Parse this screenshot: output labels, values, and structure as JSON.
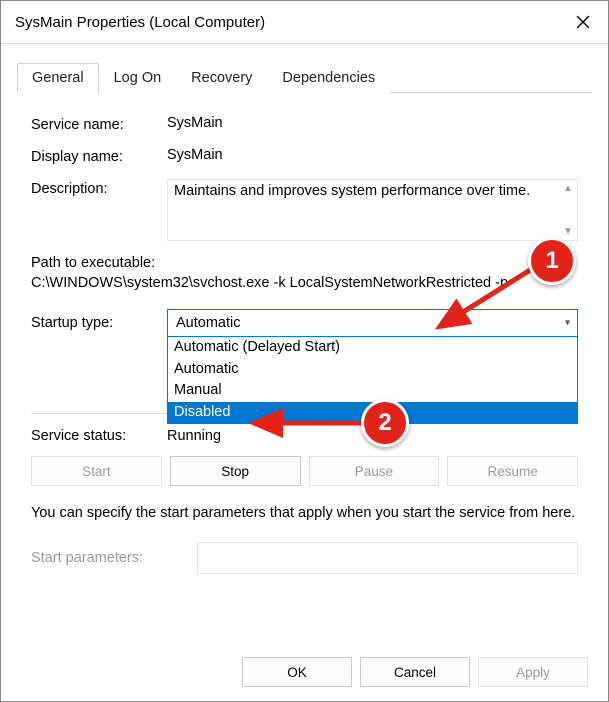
{
  "window": {
    "title": "SysMain Properties (Local Computer)"
  },
  "tabs": [
    {
      "label": "General"
    },
    {
      "label": "Log On"
    },
    {
      "label": "Recovery"
    },
    {
      "label": "Dependencies"
    }
  ],
  "labels": {
    "service_name": "Service name:",
    "display_name": "Display name:",
    "description": "Description:",
    "path_label": "Path to executable:",
    "startup_type": "Startup type:",
    "service_status": "Service status:",
    "start_parameters": "Start parameters:"
  },
  "service": {
    "name": "SysMain",
    "display_name": "SysMain",
    "description": "Maintains and improves system performance over time.",
    "path": "C:\\WINDOWS\\system32\\svchost.exe -k LocalSystemNetworkRestricted -p",
    "startup_selected": "Automatic",
    "startup_options": [
      "Automatic (Delayed Start)",
      "Automatic",
      "Manual",
      "Disabled"
    ],
    "status": "Running",
    "start_parameters": ""
  },
  "hint": "You can specify the start parameters that apply when you start the service from here.",
  "buttons": {
    "start": "Start",
    "stop": "Stop",
    "pause": "Pause",
    "resume": "Resume",
    "ok": "OK",
    "cancel": "Cancel",
    "apply": "Apply"
  },
  "annotations": {
    "callout1": "1",
    "callout2": "2"
  }
}
